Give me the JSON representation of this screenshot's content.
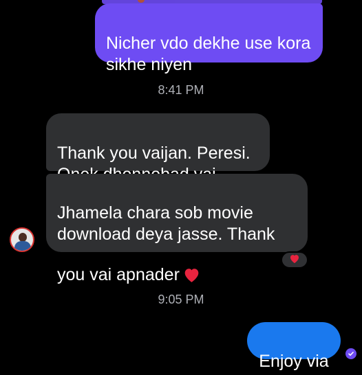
{
  "messages": {
    "out_top": "Nicher vdo dekhe use kora\nsikhe niyen",
    "time_1": "8:41 PM",
    "in_1": "Thank you vaijan. Peresi.\nOnek dhonnobad vai.",
    "in_2": "Jhamela chara sob movie\ndownload deya jasse. Thank\nyou vai apnader",
    "time_2": "9:05 PM",
    "out_bottom": "Enjoy via"
  },
  "icons": {
    "inline_emoji": "heart-icon",
    "reaction": "heart-icon",
    "seen": "check-icon"
  },
  "colors": {
    "outgoing_purple": "#6e4cf3",
    "outgoing_blue": "#1a79ee",
    "incoming": "#2f3032",
    "heart": "#e8243f"
  }
}
